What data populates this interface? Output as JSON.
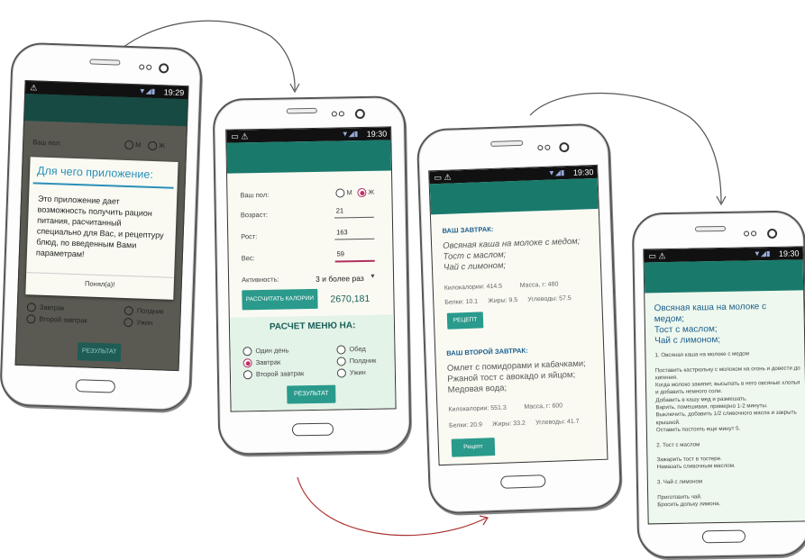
{
  "status": {
    "time1": "19:29",
    "time2": "19:30",
    "time3": "19:30",
    "time4": "19:30"
  },
  "phone1": {
    "gender_label": "Ваш пол:",
    "male": "М",
    "female": "Ж",
    "dialog_title": "Для чего приложение:",
    "dialog_text": "Это приложение дает возможность получить рацион питания, расчитанный специально для Вас, и рецептуру блюд, по введенным Вами параметрам!",
    "dialog_ok": "Понял(а)!",
    "bg_breakfast": "Завтрак",
    "bg_second_breakfast": "Второй завтрак",
    "bg_snack": "Полдник",
    "bg_dinner": "Ужин",
    "result_button": "РЕЗУЛЬТАТ"
  },
  "phone2": {
    "gender_label": "Ваш пол:",
    "male": "М",
    "female": "Ж",
    "age_label": "Возраст:",
    "age_value": "21",
    "height_label": "Рост:",
    "height_value": "163",
    "weight_label": "Вес:",
    "weight_value": "59",
    "activity_label": "Активность:",
    "activity_value": "3 и более раз",
    "calc_button": "РАССЧИТАТЬ КАЛОРИИ",
    "calories": "2670,181",
    "menu_heading": "РАСЧЕТ МЕНЮ НА:",
    "options": {
      "one_day": "Один день",
      "lunch": "Обед",
      "breakfast": "Завтрак",
      "snack": "Полдник",
      "second_breakfast": "Второй завтрак",
      "dinner": "Ужин"
    },
    "selected_option": "breakfast",
    "result_button": "РЕЗУЛЬТАТ"
  },
  "phone3": {
    "breakfast_heading": "ВАШ ЗАВТРАК:",
    "breakfast_text": "Овсяная каша на молоке с медом;\nТост с маслом;\nЧай с лимоном;",
    "b_kcal": "Килокалории: 414.5",
    "b_mass": "Масса, г: 480",
    "b_protein": "Белки: 10.1",
    "b_fat": "Жиры: 9.5",
    "b_carbs": "Углеводы: 57.5",
    "recipe_button": "РЕЦЕПТ",
    "second_heading": "ВАШ ВТОРОЙ ЗАВТРАК:",
    "second_text": "Омлет с помидорами и кабачками;\nРжаной тост с авокадо и яйцом;\nМедовая вода;",
    "s_kcal": "Килокалории: 551.3",
    "s_mass": "Масса, г: 600",
    "s_protein": "Белки: 20.9",
    "s_fat": "Жиры: 33.2",
    "s_carbs": "Углеводы: 41.7",
    "recipe_button2": "Рецепт"
  },
  "phone4": {
    "recipe_heading": "Овсяная каша на молоке с медом;\nТост с маслом;\nЧай с лимоном;",
    "recipe_body": "1. Овсяная каша на молоке с медом\n\nПоставить кастрюльку с молоком на огонь и довести до кипения.\nКогда молоко закипит, высыпать в него овсяные хлопья и добавить немного соли.\nДобавить в кашу мед и размешать.\nВарить, помешивая, примерно 1-2 минуты.\nВыключить, добавить 1/2 сливочного масла и закрыть крышкой.\nОставить постоять еще минут 5.\n\n2. Тост с маслом\n\nЗажарить тост в тостере.\nНамазать сливочным маслом.\n\n3. Чай с лимоном\n\nПриготовить чай.\nБросить дольку лимона."
  },
  "colors": {
    "accent": "#197a6c",
    "button": "#2a9a8c",
    "radio_selected": "#c0306a",
    "heading_blue": "#1d5f8d"
  }
}
